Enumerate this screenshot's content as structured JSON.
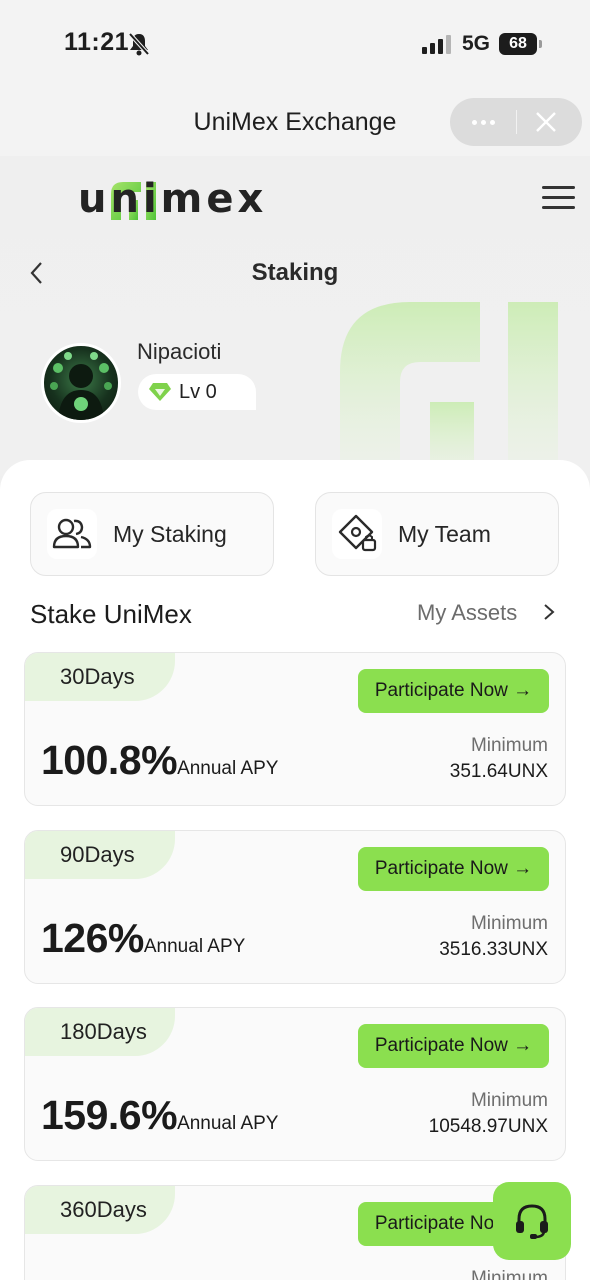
{
  "status_bar": {
    "time": "11:21",
    "network": "5G",
    "battery": "68"
  },
  "titlebar": {
    "title": "UniMex Exchange"
  },
  "header": {
    "logo_text": "unimex",
    "page_title": "Staking"
  },
  "profile": {
    "username": "Nipacioti",
    "level": "Lv 0"
  },
  "quick_links": {
    "my_staking": "My Staking",
    "my_team": "My Team"
  },
  "section": {
    "title": "Stake UniMex",
    "assets_link": "My Assets"
  },
  "plans": [
    {
      "days": "30Days",
      "button": "Participate Now →",
      "apy": "100.8%",
      "apy_label": "Annual APY",
      "min_label": "Minimum",
      "min_value": "351.64UNX"
    },
    {
      "days": "90Days",
      "button": "Participate Now →",
      "apy": "126%",
      "apy_label": "Annual APY",
      "min_label": "Minimum",
      "min_value": "3516.33UNX"
    },
    {
      "days": "180Days",
      "button": "Participate Now →",
      "apy": "159.6%",
      "apy_label": "Annual APY",
      "min_label": "Minimum",
      "min_value": "10548.97UNX"
    },
    {
      "days": "360Days",
      "button": "Participate Now →",
      "apy": "",
      "apy_label": "",
      "min_label": "Minimum",
      "min_value": ""
    }
  ],
  "colors": {
    "accent": "#8bdf4f",
    "accent_light": "#e7f4df"
  },
  "icons": [
    "bell-slash-icon",
    "signal-icon",
    "more-dots-icon",
    "close-icon",
    "menu-icon",
    "back-arrow-icon",
    "diamond-icon",
    "users-icon",
    "team-icon",
    "chevron-right-icon",
    "headset-icon"
  ]
}
